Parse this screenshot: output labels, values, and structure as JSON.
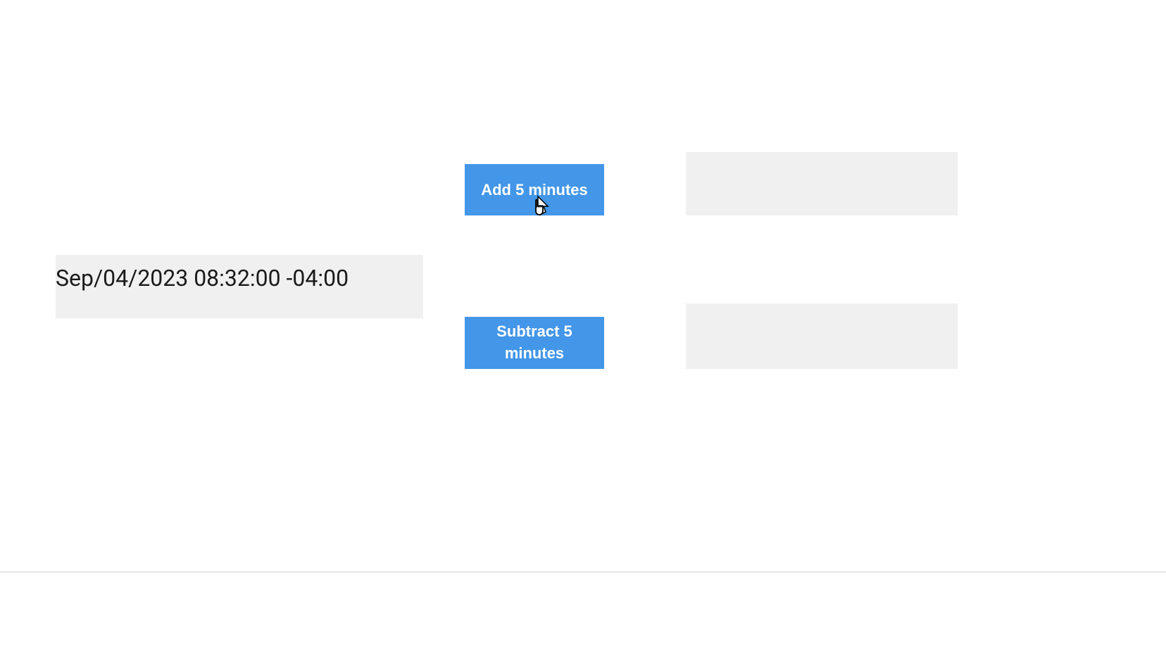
{
  "datetime": {
    "value": "Sep/04/2023 08:32:00 -04:00"
  },
  "buttons": {
    "add_label": "Add 5 minutes",
    "subtract_label": "Subtract 5 minutes"
  }
}
